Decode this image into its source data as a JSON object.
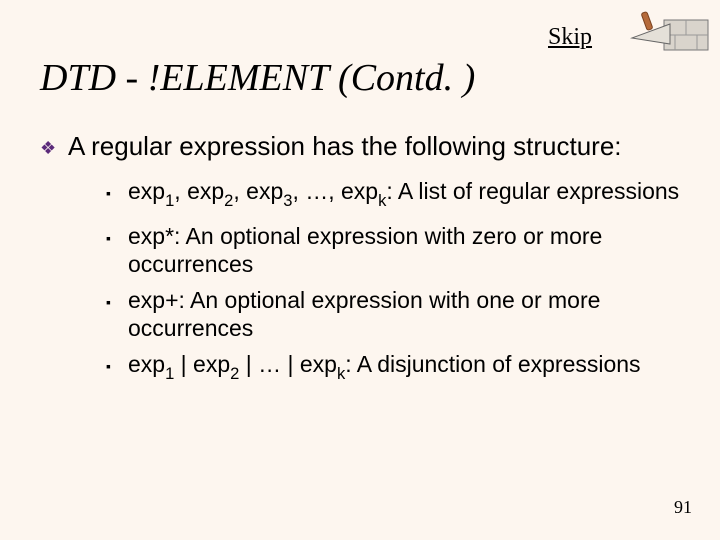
{
  "skip_label": "Skip",
  "title": "DTD - !ELEMENT (Contd. )",
  "intro": "A regular expression has the following structure:",
  "items": [
    {
      "p1": "exp",
      "s1": "1",
      "p2": ", exp",
      "s2": "2",
      "p3": ", exp",
      "s3": "3",
      "p4": ", …, exp",
      "s4": "k",
      "p5": ": A list of regular expressions"
    },
    {
      "p1": "exp*: An optional expression with zero or more occurrences"
    },
    {
      "p1": "exp+: An optional expression with one or more occurrences"
    },
    {
      "p1": "exp",
      "s1": "1",
      "p2": " | exp",
      "s2": "2",
      "p3": " | … | exp",
      "s3": "k",
      "p4": ": A disjunction of expressions"
    }
  ],
  "page_number": "91",
  "icons": {
    "diamond": "❖",
    "square": "▪"
  }
}
